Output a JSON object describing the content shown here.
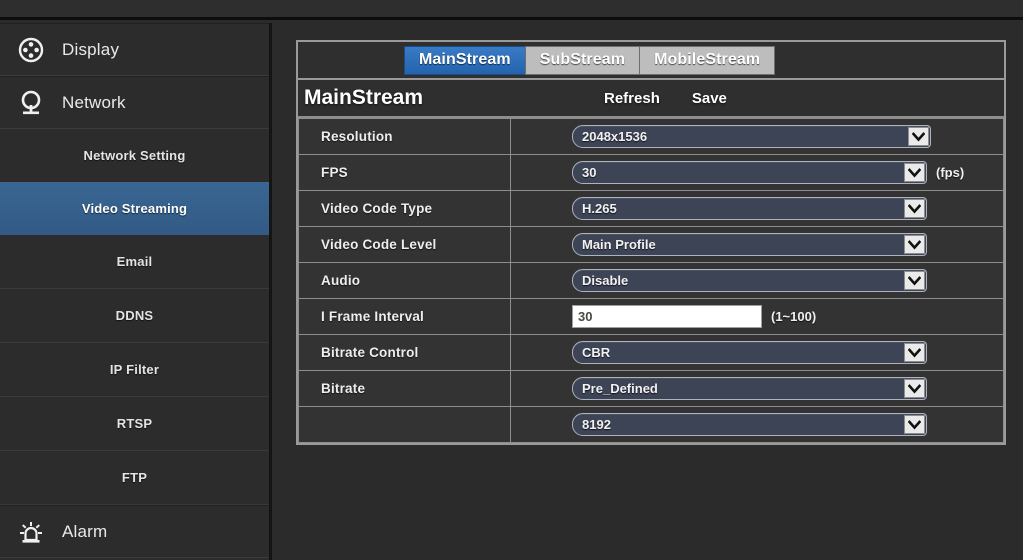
{
  "sidebar": {
    "groups": [
      {
        "type": "main",
        "icon": "display-icon",
        "label": "Display",
        "selected": false
      },
      {
        "type": "main",
        "icon": "network-camera-icon",
        "label": "Network",
        "selected": false
      },
      {
        "type": "sub",
        "label": "Network Setting",
        "selected": false
      },
      {
        "type": "sub",
        "label": "Video Streaming",
        "selected": true
      },
      {
        "type": "sub",
        "label": "Email",
        "selected": false
      },
      {
        "type": "sub",
        "label": "DDNS",
        "selected": false
      },
      {
        "type": "sub",
        "label": "IP Filter",
        "selected": false
      },
      {
        "type": "sub",
        "label": "RTSP",
        "selected": false
      },
      {
        "type": "sub",
        "label": "FTP",
        "selected": false
      },
      {
        "type": "main",
        "icon": "alarm-siren-icon",
        "label": "Alarm",
        "selected": false
      }
    ]
  },
  "panel": {
    "tabs": [
      {
        "label": "MainStream",
        "active": true
      },
      {
        "label": "SubStream",
        "active": false
      },
      {
        "label": "MobileStream",
        "active": false
      }
    ],
    "title": "MainStream",
    "refresh_label": "Refresh",
    "save_label": "Save",
    "rows": [
      {
        "label": "Resolution",
        "control": "select",
        "value": "2048x1536",
        "width": "res",
        "unit": ""
      },
      {
        "label": "FPS",
        "control": "select",
        "value": "30",
        "width": "std",
        "unit": "(fps)"
      },
      {
        "label": "Video Code Type",
        "control": "select",
        "value": "H.265",
        "width": "std",
        "unit": ""
      },
      {
        "label": "Video Code Level",
        "control": "select",
        "value": "Main Profile",
        "width": "std",
        "unit": ""
      },
      {
        "label": "Audio",
        "control": "select",
        "value": "Disable",
        "width": "std",
        "unit": ""
      },
      {
        "label": "I Frame Interval",
        "control": "input",
        "value": "30",
        "width": "std",
        "unit": "(1~100)"
      },
      {
        "label": "Bitrate Control",
        "control": "select",
        "value": "CBR",
        "width": "std",
        "unit": ""
      },
      {
        "label": "Bitrate",
        "control": "select",
        "value": "Pre_Defined",
        "width": "std",
        "unit": ""
      },
      {
        "label": "",
        "control": "select",
        "value": "8192",
        "width": "std",
        "unit": ""
      }
    ]
  },
  "colors": {
    "accent_tab": "#2a6cb8",
    "accent_sidebar_selected": "#34608e",
    "select_fill": "#3d4456",
    "panel_bg": "#2f2f2f",
    "window_bg": "#2b2b2b"
  }
}
